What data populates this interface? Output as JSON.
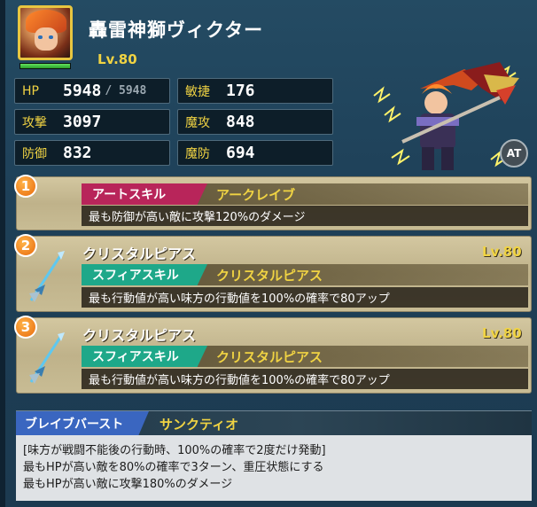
{
  "header": {
    "title": "轟雷神獅ヴィクター",
    "level": "Lv.80",
    "hp_fill": 1.0
  },
  "stats": {
    "hp": {
      "label": "HP",
      "value": "5948",
      "max": "/ 5948"
    },
    "agility": {
      "label": "敏捷",
      "value": "176"
    },
    "attack": {
      "label": "攻撃",
      "value": "3097"
    },
    "magic_attack": {
      "label": "魔攻",
      "value": "848"
    },
    "defense": {
      "label": "防御",
      "value": "832"
    },
    "magic_defense": {
      "label": "魔防",
      "value": "694"
    }
  },
  "at_badge": "AT",
  "skills": [
    {
      "number": "1",
      "tag": "アートスキル",
      "tag_name": "アークレイブ",
      "description": "最も防御が高い敵に攻撃120%のダメージ"
    },
    {
      "number": "2",
      "name": "クリスタルピアス",
      "level": "Lv.80",
      "tag": "スフィアスキル",
      "tag_name": "クリスタルピアス",
      "description": "最も行動値が高い味方の行動値を100%の確率で80アップ"
    },
    {
      "number": "3",
      "name": "クリスタルピアス",
      "level": "Lv.80",
      "tag": "スフィアスキル",
      "tag_name": "クリスタルピアス",
      "description": "最も行動値が高い味方の行動値を100%の確率で80アップ"
    }
  ],
  "brave_burst": {
    "tag": "ブレイブバースト",
    "name": "サンクティオ",
    "lines": [
      "[味方が戦闘不能後の行動時、100%の確率で2度だけ発動]",
      "最もHPが高い敵を80%の確率で3ターン、重圧状態にする",
      "最もHPが高い敵に攻撃180%のダメージ"
    ]
  },
  "colors": {
    "accent_gold": "#f0d343",
    "art_tag": "#b8255a",
    "sphere_tag": "#1ea889",
    "brave_tag": "#3a66c0"
  },
  "icons": [
    "character-portrait",
    "crystal-spear-icon",
    "at-badge"
  ]
}
